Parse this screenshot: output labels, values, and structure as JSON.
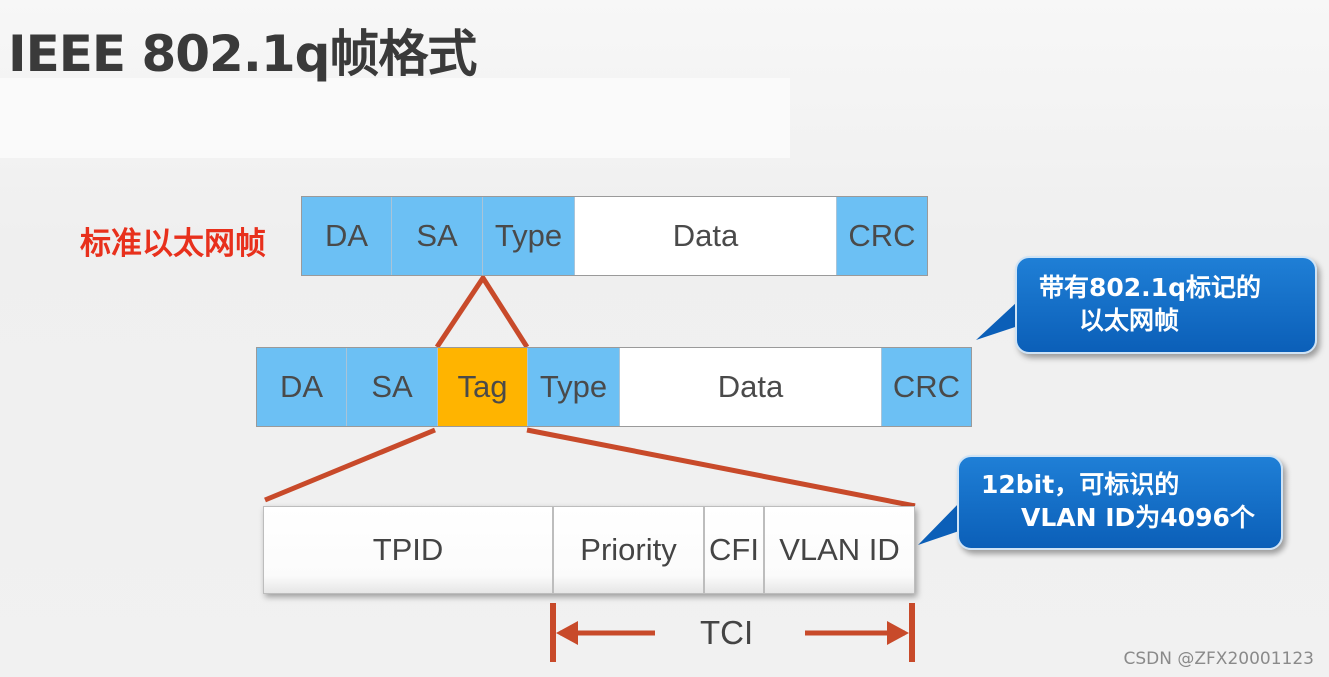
{
  "title": "IEEE 802.1q帧格式",
  "standard_frame": {
    "label": "标准以太网帧",
    "fields": [
      "DA",
      "SA",
      "Type",
      "Data",
      "CRC"
    ]
  },
  "tagged_frame": {
    "fields": [
      "DA",
      "SA",
      "Tag",
      "Type",
      "Data",
      "CRC"
    ],
    "callout_line1": "带有802.1q标记的",
    "callout_line2": "以太网帧"
  },
  "tag_detail": {
    "fields": [
      "TPID",
      "Priority",
      "CFI",
      "VLAN ID"
    ],
    "tci_label": "TCI",
    "callout_line1": "12bit，可标识的",
    "callout_line2": "VLAN ID为4096个"
  },
  "colors": {
    "field_blue": "#6cc0f4",
    "tag_orange": "#ffb400",
    "connector_red": "#c84a2a",
    "label_red": "#e8301c",
    "callout_blue": "#0b5fb8"
  },
  "watermark": "CSDN @ZFX20001123"
}
